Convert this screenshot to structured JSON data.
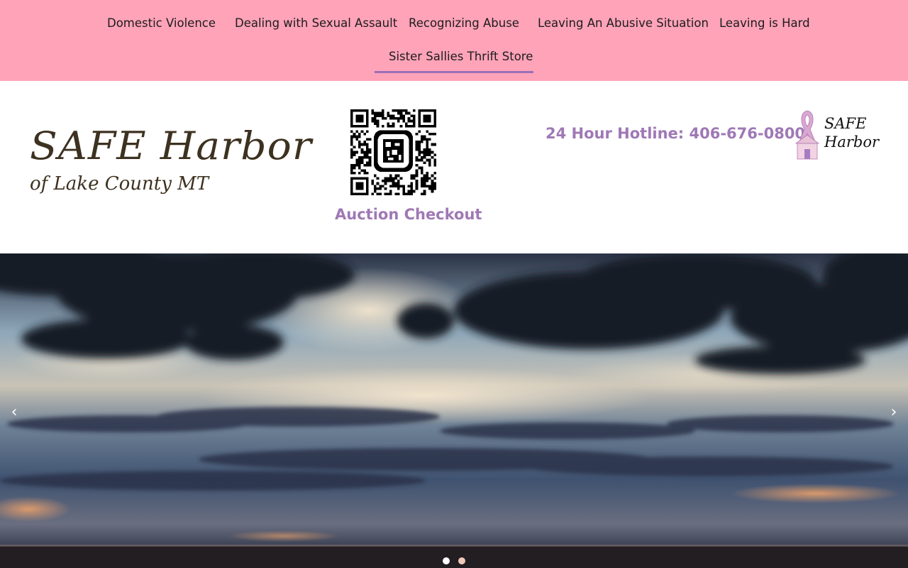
{
  "nav": {
    "items": [
      {
        "label": "Domestic Violence"
      },
      {
        "label": "Dealing with Sexual Assault"
      },
      {
        "label": "Recognizing Abuse"
      },
      {
        "label": "Leaving An Abusive Situation"
      },
      {
        "label": "Leaving is Hard"
      },
      {
        "label": "Sister Sallies Thrift Store",
        "active": true
      }
    ]
  },
  "header": {
    "logo_main": "SAFE Harbor",
    "logo_sub": "of Lake County MT",
    "qr_caption": "Auction Checkout",
    "hotline": "24 Hour Hotline: 406-676-0800",
    "mini_logo_line1": "SAFE",
    "mini_logo_line2": "Harbor"
  },
  "slider": {
    "prev_icon": "chevron-left-icon",
    "next_icon": "chevron-right-icon",
    "prev_glyph": "‹",
    "next_glyph": "›",
    "slides_total": 2,
    "current_slide": 1
  },
  "colors": {
    "nav_bg": "#ffa3b9",
    "accent_purple": "#9f78b5",
    "logo_brown": "#3d3120"
  }
}
